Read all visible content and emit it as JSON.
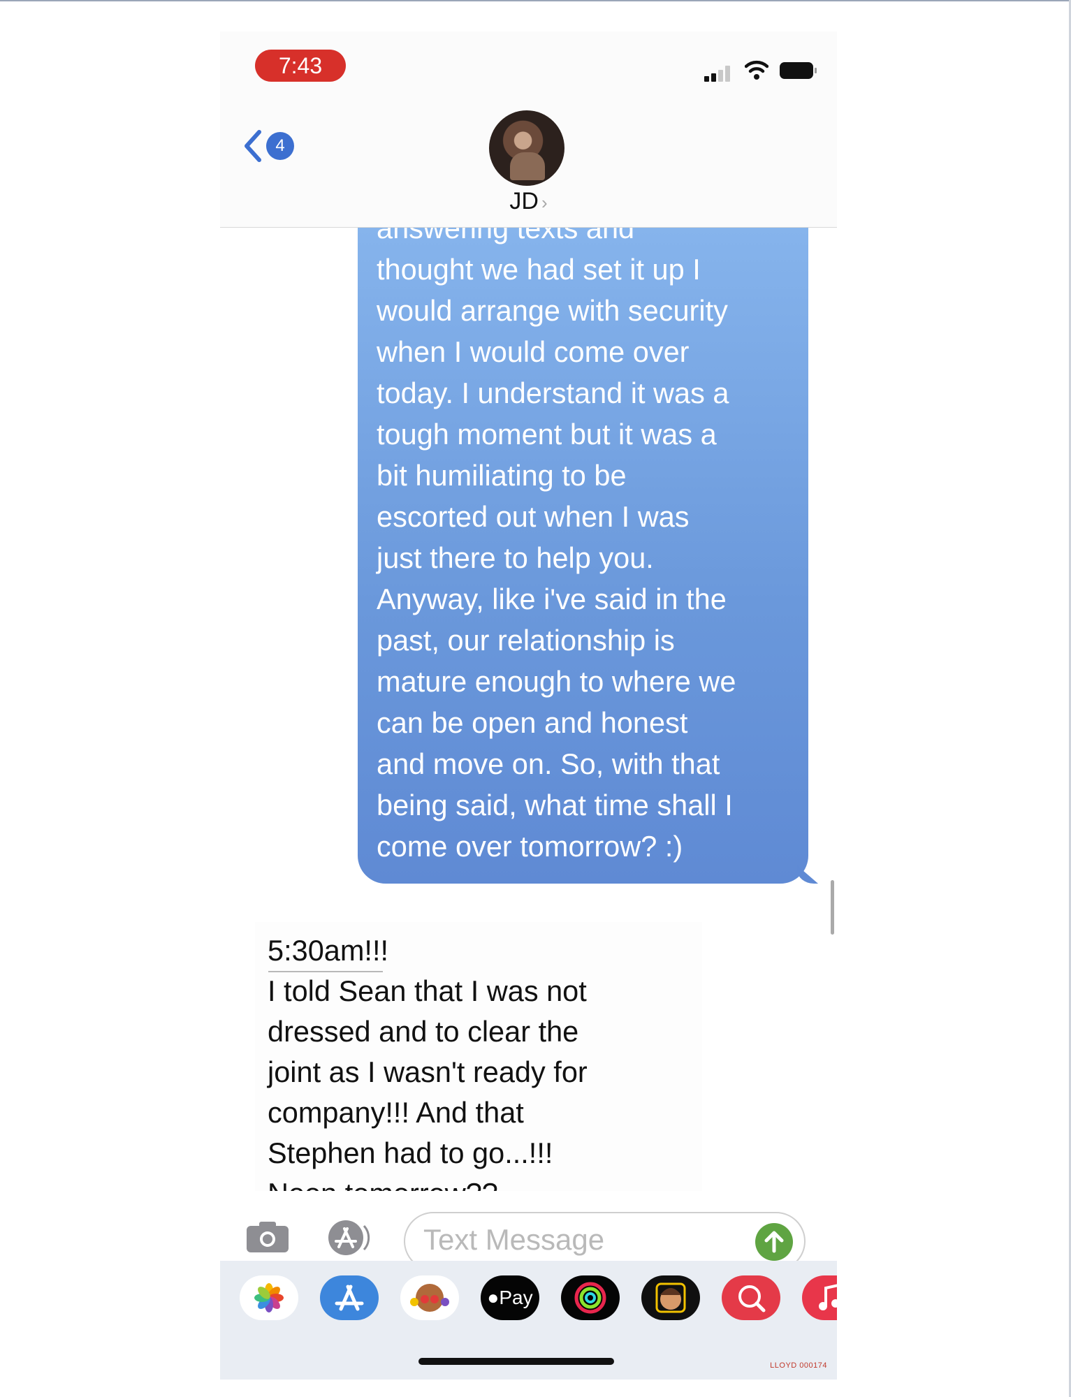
{
  "status_bar": {
    "time": "7:43"
  },
  "header": {
    "back_badge": "4",
    "contact_name": "JD",
    "chevron": "›"
  },
  "messages": {
    "outgoing_text": "answering texts and\nthought we had set it up I\nwould arrange with security\nwhen I would come over\ntoday.  I understand it was a\ntough moment but it was a\nbit humiliating to be\nescorted out when I was\njust there to help you.\nAnyway, like i've said in the\npast, our relationship is\nmature enough to where we\ncan be open and honest\nand move on. So, with that\nbeing said, what time shall I\ncome over tomorrow? :)",
    "incoming_text": "5:30am!!!\nI told Sean that I was not\ndressed and to clear the\njoint as I wasn't ready for\ncompany!!! And that\nStephen had to go...!!!\nNoon tomorrow??"
  },
  "composer": {
    "placeholder": "Text Message"
  },
  "app_drawer": {
    "items": [
      "photos-icon",
      "app-store-icon",
      "memoji-stickers-icon",
      "apple-pay-icon",
      "activity-icon",
      "memoji-icon",
      "search-images-icon",
      "music-icon"
    ],
    "apple_pay_label": "Pay"
  },
  "footer": {
    "bates_number": "LLOYD 000174"
  },
  "colors": {
    "outgoing_bubble": "#6a98db",
    "time_pill": "#d7302a",
    "send_button": "#5fa442",
    "badge": "#3c6fd0"
  }
}
